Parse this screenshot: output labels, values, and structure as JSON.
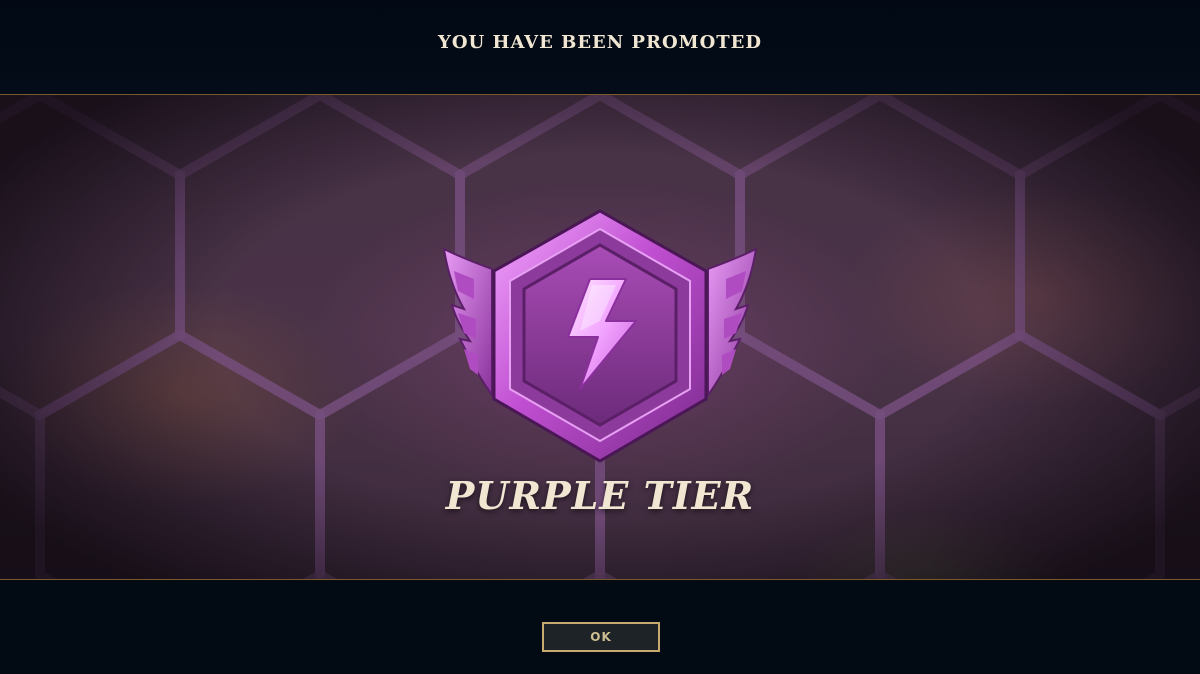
{
  "banner": {
    "title": "YOU HAVE BEEN PROMOTED"
  },
  "rank": {
    "tier_name": "PURPLE TIER",
    "emblem_icon": "lightning-bolt-icon",
    "accent_color": "#c04fd1"
  },
  "actions": {
    "ok_label": "OK"
  },
  "colors": {
    "text_gold": "#f0e6d2",
    "border_gold": "#785a28",
    "button_border": "#c8aa6e",
    "background": "#020b15"
  }
}
